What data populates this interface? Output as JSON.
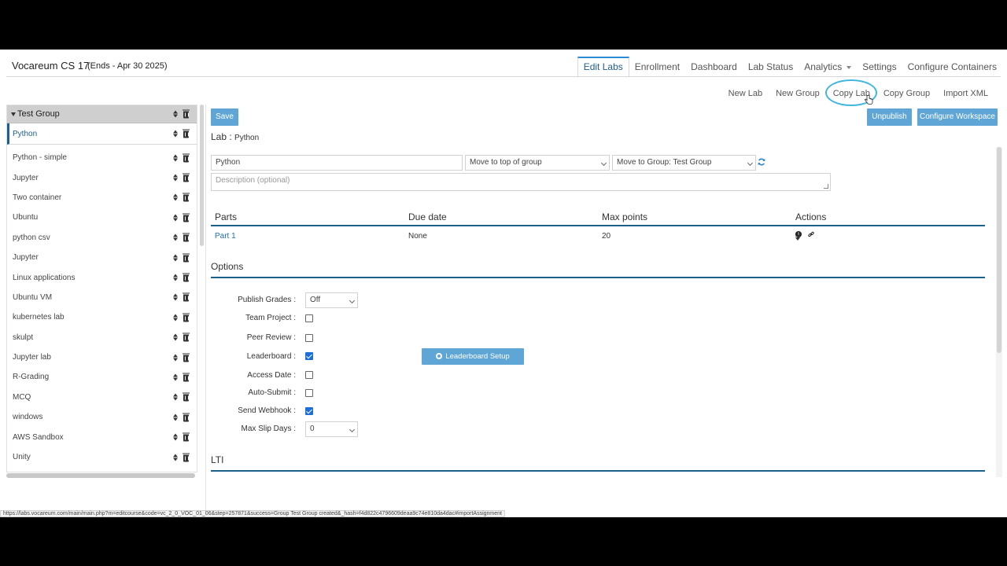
{
  "header": {
    "course_title": "Vocareum CS 17",
    "course_ends": "(Ends - Apr 30 2025)"
  },
  "top_nav": [
    {
      "label": "Edit Labs"
    },
    {
      "label": "Enrollment"
    },
    {
      "label": "Dashboard"
    },
    {
      "label": "Lab Status"
    },
    {
      "label": "Analytics"
    },
    {
      "label": "Settings"
    },
    {
      "label": "Configure Containers"
    }
  ],
  "sub_nav": [
    {
      "label": "New Lab"
    },
    {
      "label": "New Group"
    },
    {
      "label": "Copy Lab"
    },
    {
      "label": "Copy Group"
    },
    {
      "label": "Import XML"
    }
  ],
  "sidebar": {
    "group_name": "Test Group",
    "active_lab": "Python",
    "labs": [
      "Python - simple",
      "Jupyter",
      "Two container",
      "Ubuntu",
      "python csv",
      "Jupyter",
      "Linux applications",
      "Ubuntu VM",
      "kubernetes lab",
      "skulpt",
      "Jupyter lab",
      "R-Grading",
      "MCQ",
      "windows",
      "AWS Sandbox",
      "Unity"
    ]
  },
  "toolbar": {
    "save_label": "Save",
    "unpublish_label": "Unpublish",
    "configure_workspace_label": "Configure Workspace"
  },
  "lab": {
    "label_prefix": "Lab :",
    "name": "Python",
    "name_value": "Python",
    "position_select": "Move to top of group",
    "group_select": "Move to Group: Test Group",
    "description_placeholder": "Description (optional)"
  },
  "parts": {
    "headers": [
      "Parts",
      "Due date",
      "Max points",
      "Actions"
    ],
    "rows": [
      {
        "name": "Part 1",
        "due": "None",
        "points": "20"
      }
    ]
  },
  "options": {
    "title": "Options",
    "publish_grades_label": "Publish Grades :",
    "publish_grades_value": "Off",
    "team_project_label": "Team Project :",
    "peer_review_label": "Peer Review :",
    "leaderboard_label": "Leaderboard :",
    "access_date_label": "Access Date :",
    "auto_submit_label": "Auto-Submit :",
    "send_webhook_label": "Send Webhook :",
    "max_slip_days_label": "Max Slip Days :",
    "max_slip_days_value": "0",
    "leaderboard_setup_label": "Leaderboard Setup",
    "team_project": false,
    "peer_review": false,
    "leaderboard": true,
    "access_date": false,
    "auto_submit": false,
    "send_webhook": true
  },
  "lti": {
    "title": "LTI"
  },
  "status_bar": {
    "url": "https://labs.vocareum.com/main/main.php?m=editcourse&code=vc_2_0_VOC_01_06&step=257871&success=Group Test Group created&_hash=f4d822c4796609deaa9c74e810da4dac#importAssignment"
  },
  "colors": {
    "accent": "#1d5f8e",
    "button": "#5fa6d6",
    "highlight_ring": "#3fb6e0"
  }
}
